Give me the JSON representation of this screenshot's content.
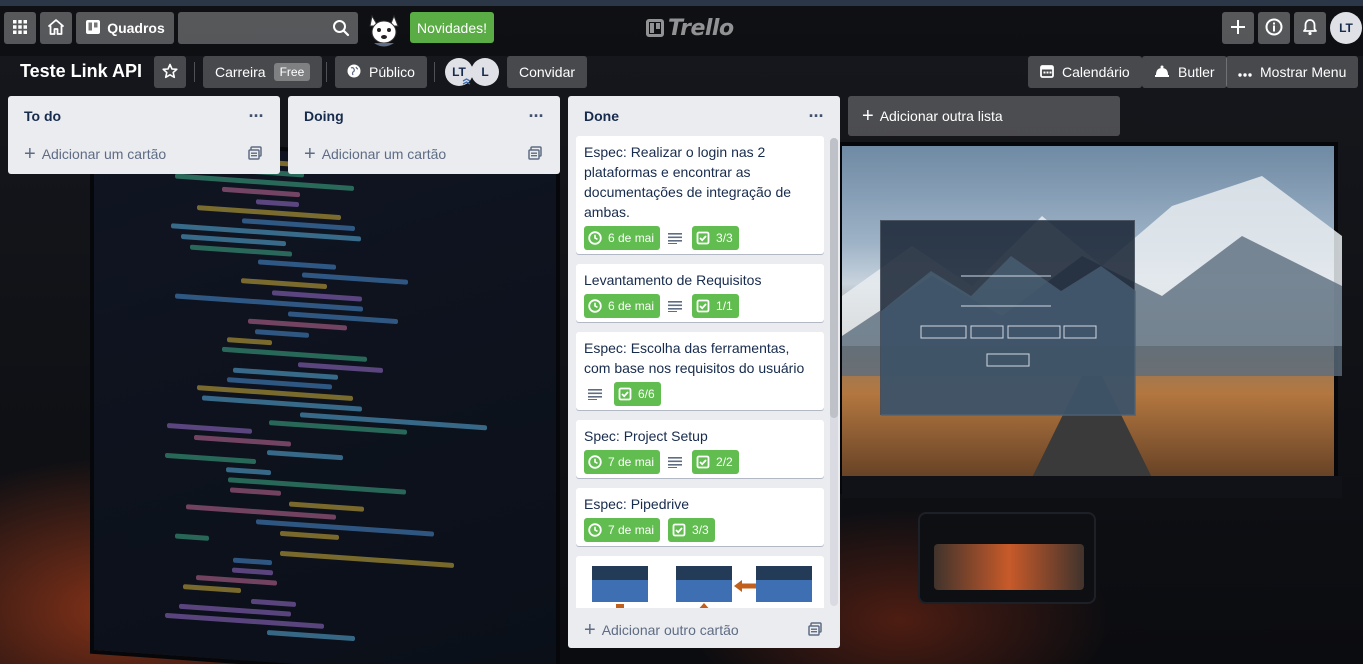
{
  "header": {
    "boards_label": "Quadros",
    "news_label": "Novidades!",
    "logo_text": "Trello",
    "user_initials": "LT"
  },
  "board": {
    "title": "Teste Link API",
    "team_label": "Carreira",
    "team_tag": "Free",
    "visibility_label": "Público",
    "members": [
      "LT",
      "L"
    ],
    "invite_label": "Convidar",
    "calendar_label": "Calendário",
    "butler_label": "Butler",
    "menu_label": "Mostrar Menu"
  },
  "lists": [
    {
      "name": "To do",
      "add_card_label": "Adicionar um cartão"
    },
    {
      "name": "Doing",
      "add_card_label": "Adicionar um cartão"
    },
    {
      "name": "Done",
      "add_card_label": "Adicionar outro cartão",
      "cards": [
        {
          "title": "Espec: Realizar o login nas 2 plataformas e encontrar as documentações de integração de ambas.",
          "due": "6 de mai",
          "has_description": true,
          "checklist": "3/3"
        },
        {
          "title": "Levantamento de Requisitos",
          "due": "6 de mai",
          "has_description": true,
          "checklist": "1/1"
        },
        {
          "title": "Espec: Escolha das ferramentas, com base nos requisitos do usuário",
          "due": "",
          "has_description": true,
          "checklist": "6/6"
        },
        {
          "title": "Spec: Project Setup",
          "due": "7 de mai",
          "has_description": true,
          "checklist": "2/2"
        },
        {
          "title": "Espec: Pipedrive",
          "due": "7 de mai",
          "has_description": false,
          "checklist": "3/3"
        }
      ]
    }
  ],
  "add_list_label": "Adicionar outra lista",
  "colors": {
    "green": "#61bd4f",
    "news_green": "#5aac44",
    "list_bg": "#ebecf0",
    "text": "#172b4d"
  },
  "icons": [
    "apps-icon",
    "home-icon",
    "boards-icon",
    "search-icon",
    "plus-icon",
    "info-icon",
    "bell-icon",
    "star-icon",
    "globe-icon",
    "calendar-icon",
    "butler-icon",
    "ellipsis-icon",
    "clock-icon",
    "checklist-icon",
    "description-icon",
    "template-icon"
  ]
}
